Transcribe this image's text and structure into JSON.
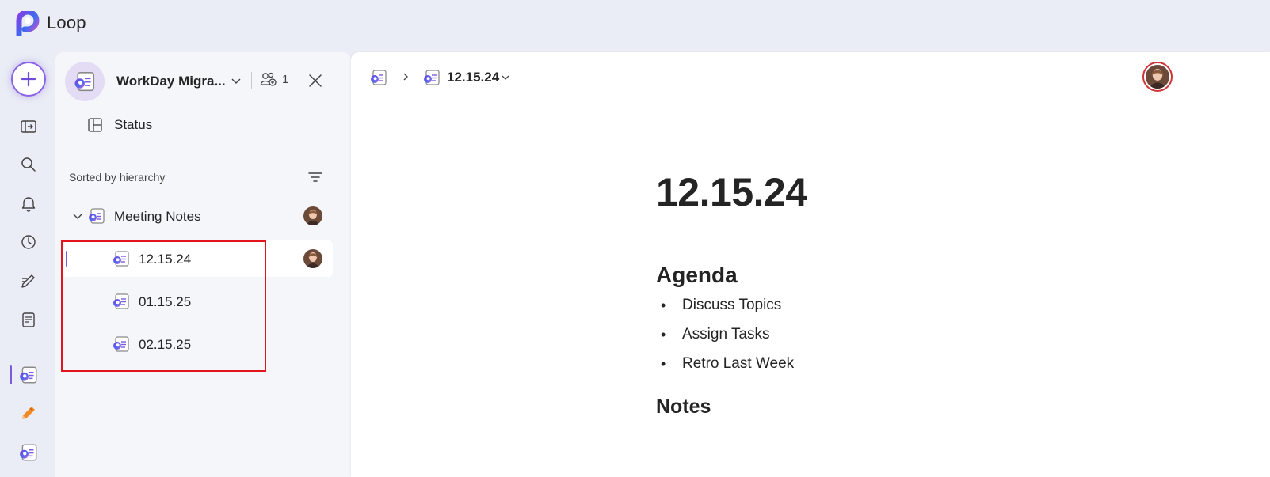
{
  "app": {
    "name": "Loop"
  },
  "workspace": {
    "title": "WorkDay Migra...",
    "member_count": "1",
    "status_label": "Status"
  },
  "tree": {
    "sort_label": "Sorted by hierarchy",
    "parent": {
      "label": "Meeting Notes"
    },
    "children": [
      {
        "label": "12.15.24",
        "selected": true
      },
      {
        "label": "01.15.25",
        "selected": false
      },
      {
        "label": "02.15.25",
        "selected": false
      }
    ]
  },
  "breadcrumb": {
    "current": "12.15.24"
  },
  "document": {
    "title": "12.15.24",
    "sections": [
      {
        "heading": "Agenda",
        "items": [
          "Discuss Topics",
          "Assign Tasks",
          "Retro Last Week"
        ]
      },
      {
        "heading": "Notes",
        "items": []
      }
    ]
  },
  "colors": {
    "accent": "#7b5be0",
    "highlight_border": "#e3141b",
    "avatar_ring": "#d13438"
  },
  "icons": {
    "rail": [
      "new-icon",
      "open-panel-icon",
      "search-icon",
      "bell-icon",
      "recent-clock-icon",
      "ideas-pen-icon",
      "notes-icon",
      "workspace-icon",
      "edit-pencil-icon",
      "workspace-icon-2"
    ]
  }
}
